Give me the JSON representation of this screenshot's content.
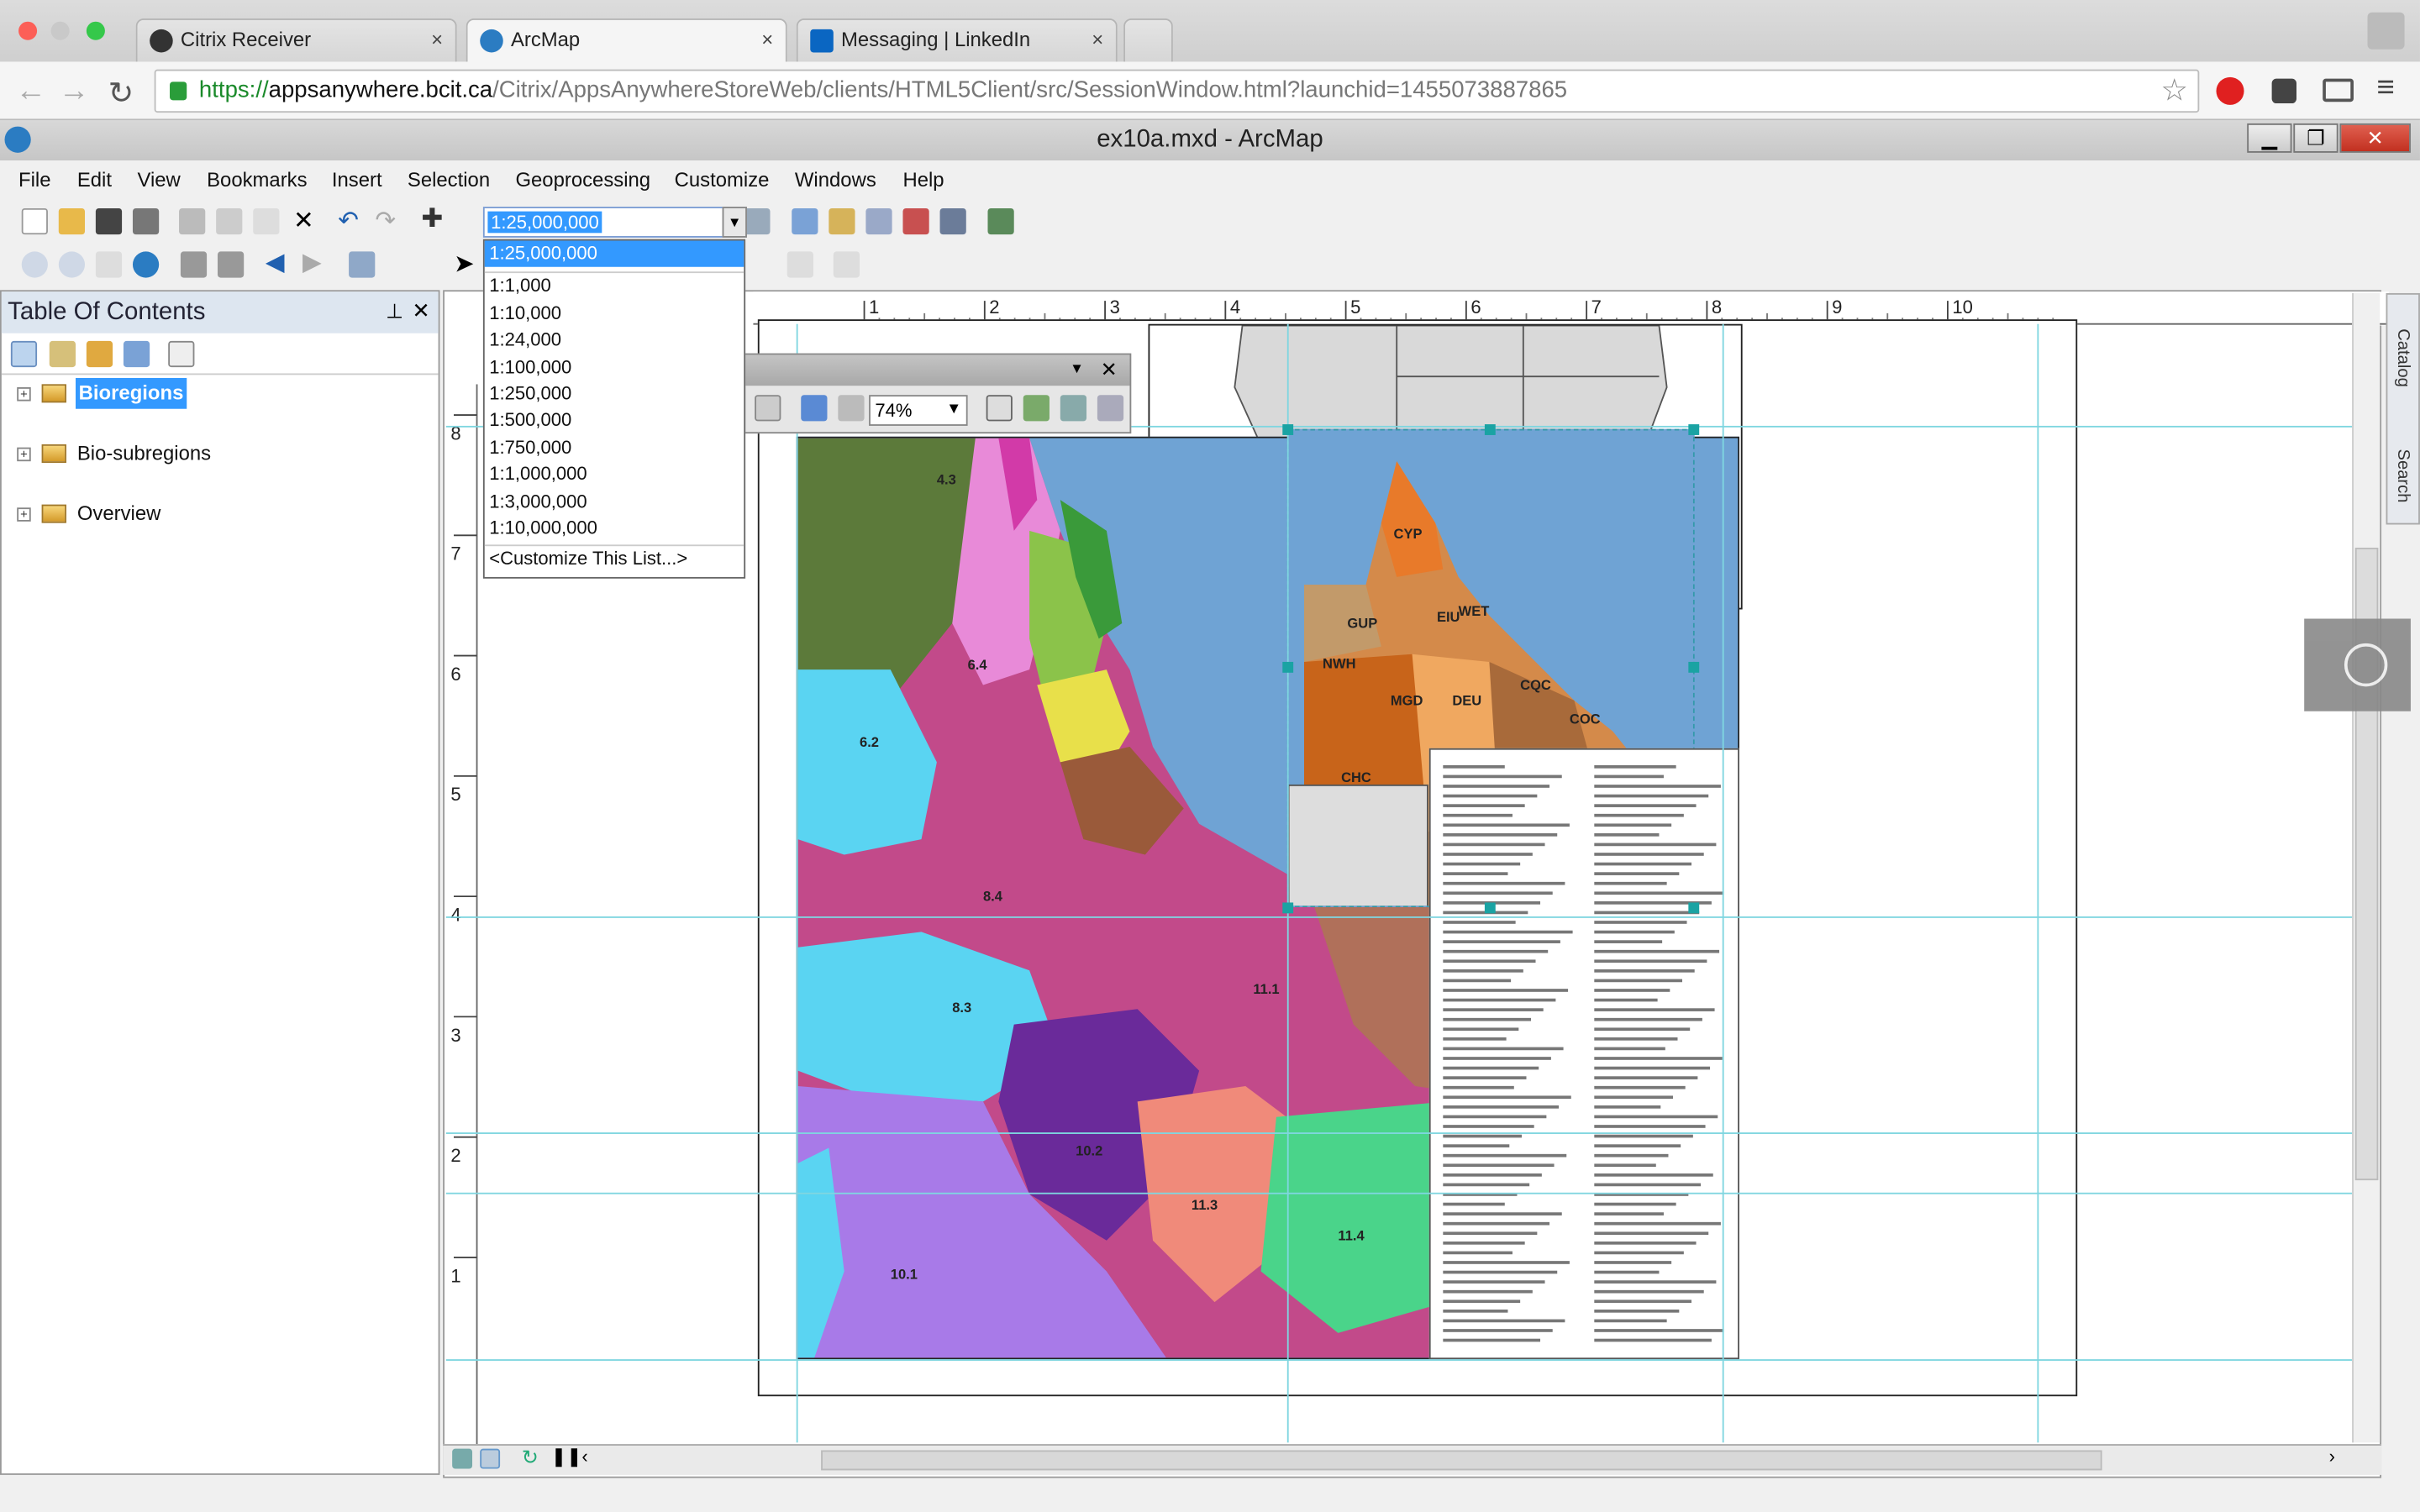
{
  "browser": {
    "tabs": [
      {
        "label": "Citrix Receiver",
        "close": "×"
      },
      {
        "label": "ArcMap",
        "close": "×"
      },
      {
        "label": "Messaging | LinkedIn",
        "close": "×"
      }
    ],
    "url_https": "https://",
    "url_host": "appsanywhere.bcit.ca",
    "url_path": "/Citrix/AppsAnywhereStoreWeb/clients/HTML5Client/src/SessionWindow.html?launchid=1455073887865"
  },
  "app": {
    "title": "ex10a.mxd - ArcMap",
    "menu": [
      "File",
      "Edit",
      "View",
      "Bookmarks",
      "Insert",
      "Selection",
      "Geoprocessing",
      "Customize",
      "Windows",
      "Help"
    ],
    "scale_value": "1:25,000,000",
    "scale_options": [
      "1:25,000,000",
      "1:1,000",
      "1:10,000",
      "1:24,000",
      "1:100,000",
      "1:250,000",
      "1:500,000",
      "1:750,000",
      "1:1,000,000",
      "1:3,000,000",
      "1:10,000,000"
    ],
    "scale_customize": "<Customize This List...>",
    "zoom_value": "74%"
  },
  "toc": {
    "title": "Table Of Contents",
    "layers": [
      "Bioregions",
      "Bio-subregions",
      "Overview"
    ]
  },
  "ruler": {
    "top": [
      "1",
      "2",
      "3",
      "4",
      "5",
      "6",
      "7",
      "8",
      "9",
      "10"
    ],
    "left": [
      "8",
      "7",
      "6",
      "5",
      "4",
      "3",
      "2",
      "1"
    ]
  },
  "inset_labels": [
    "CYP",
    "GUP",
    "EIU",
    "WET",
    "NWH",
    "CQC",
    "MGD",
    "DEU",
    "CHC",
    "COC"
  ],
  "dock": {
    "catalog": "Catalog",
    "search": "Search"
  },
  "colors": {
    "water": "#6fa3d4",
    "accent": "#3399ff",
    "guide": "#7fd6e0"
  }
}
